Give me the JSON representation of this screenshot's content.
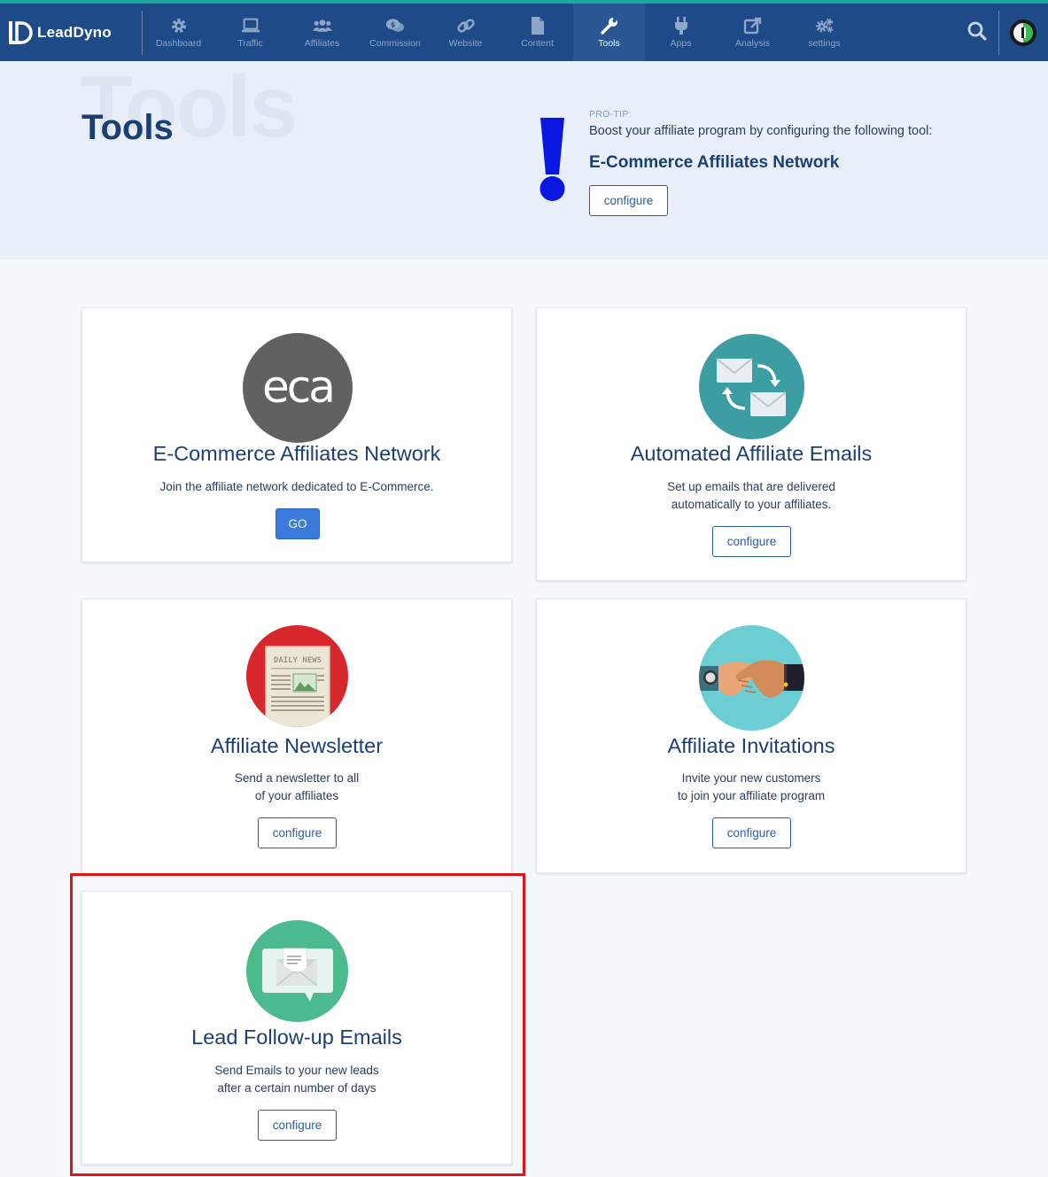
{
  "app": {
    "name": "LeadDyno"
  },
  "nav": {
    "items": [
      {
        "label": "Dashboard",
        "icon": "gear-icon"
      },
      {
        "label": "Traffic",
        "icon": "laptop-icon"
      },
      {
        "label": "Affiliates",
        "icon": "users-icon"
      },
      {
        "label": "Commission",
        "icon": "money-chat-icon"
      },
      {
        "label": "Website",
        "icon": "link-icon"
      },
      {
        "label": "Content",
        "icon": "document-icon"
      },
      {
        "label": "Tools",
        "icon": "wrench-icon",
        "active": true
      },
      {
        "label": "Apps",
        "icon": "plug-icon"
      },
      {
        "label": "Analysis",
        "icon": "external-edit-icon"
      },
      {
        "label": "settings",
        "icon": "gears-icon"
      }
    ]
  },
  "hero": {
    "watermark": "Tools",
    "title": "Tools",
    "tip_label": "PRO-TIP:",
    "tip_text": "Boost your affiliate program by configuring the following tool:",
    "tip_tool_name": "E-Commerce Affiliates Network",
    "tip_button": "configure"
  },
  "cards": [
    {
      "title": "E-Commerce Affiliates Network",
      "icon_text": "eca",
      "desc": [
        "Join the affiliate network dedicated to E-Commerce."
      ],
      "button": "GO"
    },
    {
      "title": "Automated Affiliate Emails",
      "desc": [
        "Set up emails that are delivered",
        "automatically to your affiliates."
      ],
      "button": "configure"
    },
    {
      "title": "Affiliate Newsletter",
      "icon_text": "DAILY NEWS",
      "desc": [
        "Send a newsletter to all",
        "of your affiliates"
      ],
      "button": "configure"
    },
    {
      "title": "Affiliate Invitations",
      "desc": [
        "Invite your new customers",
        "to join your affiliate program"
      ],
      "button": "configure"
    },
    {
      "title": "Lead Follow-up Emails",
      "desc": [
        "Send Emails to your new leads",
        "after a certain number of days"
      ],
      "button": "configure"
    }
  ],
  "colors": {
    "nav_bg": "#1e4a87",
    "accent": "#1fa6a0",
    "title_blue": "#1c3f73",
    "go_blue": "#3a7bdc",
    "highlight_red": "#e0141a"
  }
}
